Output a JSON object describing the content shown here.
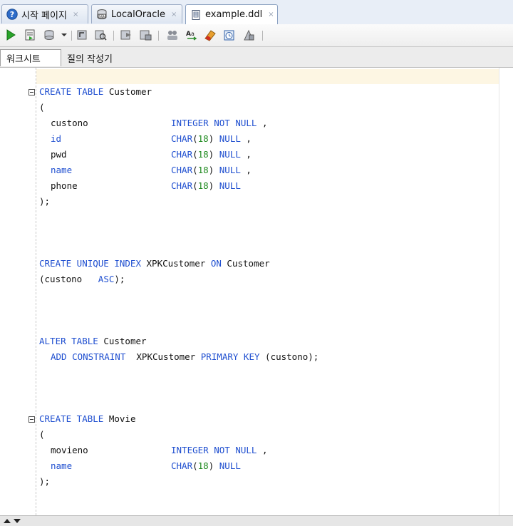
{
  "tabs": [
    {
      "label": "시작 페이지",
      "icon": "help-icon",
      "active": false
    },
    {
      "label": "LocalOracle",
      "icon": "database-connection-icon",
      "active": false
    },
    {
      "label": "example.ddl",
      "icon": "sql-file-icon",
      "active": true
    }
  ],
  "close_glyph": "×",
  "toolbar": {
    "items": [
      "run-statement-icon",
      "run-script-icon",
      "commit-icon",
      "dropdown-icon",
      "rollback-icon",
      "explain-plan-icon",
      "autotrace-icon",
      "sql-tuning-icon",
      "unshared-icon",
      "format-icon",
      "clear-icon",
      "history-icon",
      "options-icon"
    ]
  },
  "subtabs": [
    {
      "label": "워크시트",
      "active": true
    },
    {
      "label": "질의 작성기",
      "active": false
    }
  ],
  "code": {
    "create_table_customer": {
      "k1": "CREATE TABLE",
      "name": " Customer"
    },
    "open_paren": "(",
    "customer_columns": [
      {
        "col": "custono",
        "type": "INTEGER",
        "size": "",
        "null": "NOT NULL",
        "sep": " ,"
      },
      {
        "col": "id",
        "type": "CHAR",
        "size": "18",
        "null": "NULL",
        "sep": " ,"
      },
      {
        "col": "pwd",
        "type": "CHAR",
        "size": "18",
        "null": "NULL",
        "sep": " ,"
      },
      {
        "col": "name",
        "type": "CHAR",
        "size": "18",
        "null": "NULL",
        "sep": " ,"
      },
      {
        "col": "phone",
        "type": "CHAR",
        "size": "18",
        "null": "NULL",
        "sep": ""
      }
    ],
    "close_paren": ");",
    "create_index": {
      "k1": "CREATE UNIQUE INDEX",
      "name": " XPKCustomer ",
      "k2": "ON",
      "tbl": " Customer"
    },
    "index_cols": {
      "open": "(custono   ",
      "k": "ASC",
      "close": ");"
    },
    "alter_table": {
      "k1": "ALTER TABLE",
      "name": " Customer"
    },
    "add_constraint": {
      "k1": "ADD CONSTRAINT",
      "name": "  XPKCustomer ",
      "k2": "PRIMARY KEY",
      "cols": " (custono);"
    },
    "create_table_movie": {
      "k1": "CREATE TABLE",
      "name": " Movie"
    },
    "movie_columns": [
      {
        "col": "movieno",
        "type": "INTEGER",
        "size": "",
        "null": "NOT NULL",
        "sep": " ,"
      },
      {
        "col": "name",
        "type": "CHAR",
        "size": "18",
        "null": "NULL",
        "sep": ""
      }
    ]
  },
  "colors": {
    "keyword": "#1f4fd0",
    "number": "#1e8a1e",
    "current_line": "#fdf6e3"
  }
}
